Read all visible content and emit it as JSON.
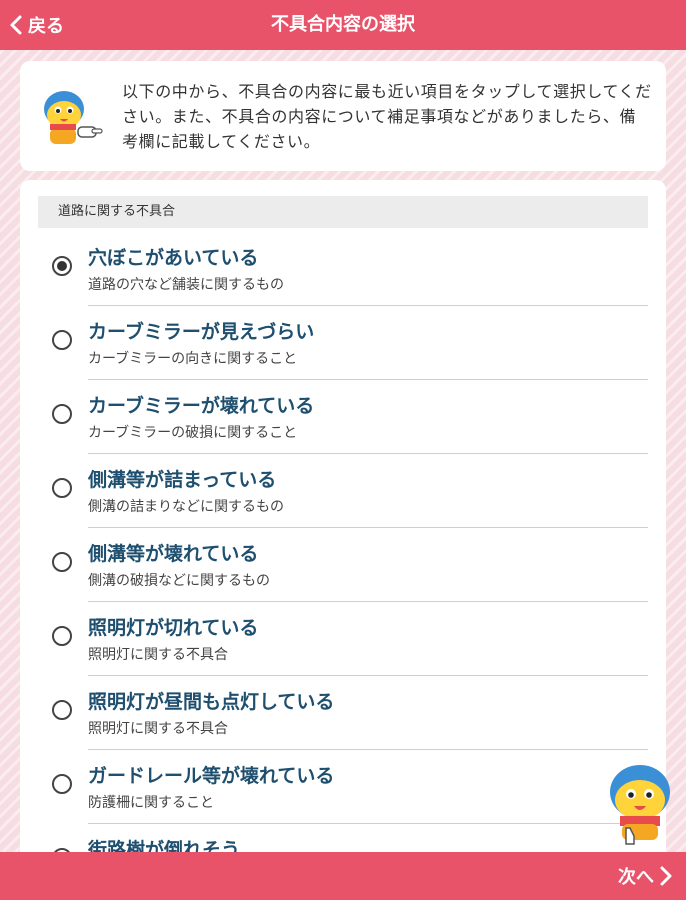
{
  "header": {
    "back_label": "戻る",
    "title": "不具合内容の選択"
  },
  "intro": {
    "text": "以下の中から、不具合の内容に最も近い項目をタップして選択してください。また、不具合の内容について補足事項などがありましたら、備考欄に記載してください。",
    "mascot_icon": "mascot-pointing-icon"
  },
  "section": {
    "label": "道路に関する不具合"
  },
  "options": [
    {
      "title": "穴ぼこがあいている",
      "subtitle": "道路の穴など舗装に関するもの",
      "selected": true
    },
    {
      "title": "カーブミラーが見えづらい",
      "subtitle": "カーブミラーの向きに関すること",
      "selected": false
    },
    {
      "title": "カーブミラーが壊れている",
      "subtitle": "カーブミラーの破損に関すること",
      "selected": false
    },
    {
      "title": "側溝等が詰まっている",
      "subtitle": "側溝の詰まりなどに関するもの",
      "selected": false
    },
    {
      "title": "側溝等が壊れている",
      "subtitle": "側溝の破損などに関するもの",
      "selected": false
    },
    {
      "title": "照明灯が切れている",
      "subtitle": "照明灯に関する不具合",
      "selected": false
    },
    {
      "title": "照明灯が昼間も点灯している",
      "subtitle": "照明灯に関する不具合",
      "selected": false
    },
    {
      "title": "ガードレール等が壊れている",
      "subtitle": "防護柵に関すること",
      "selected": false
    },
    {
      "title": "街路樹が倒れそう",
      "subtitle": "",
      "selected": false
    }
  ],
  "footer": {
    "next_label": "次へ"
  },
  "colors": {
    "accent": "#e8536a",
    "option_title": "#1f4f6f",
    "background": "#f6dde2"
  }
}
